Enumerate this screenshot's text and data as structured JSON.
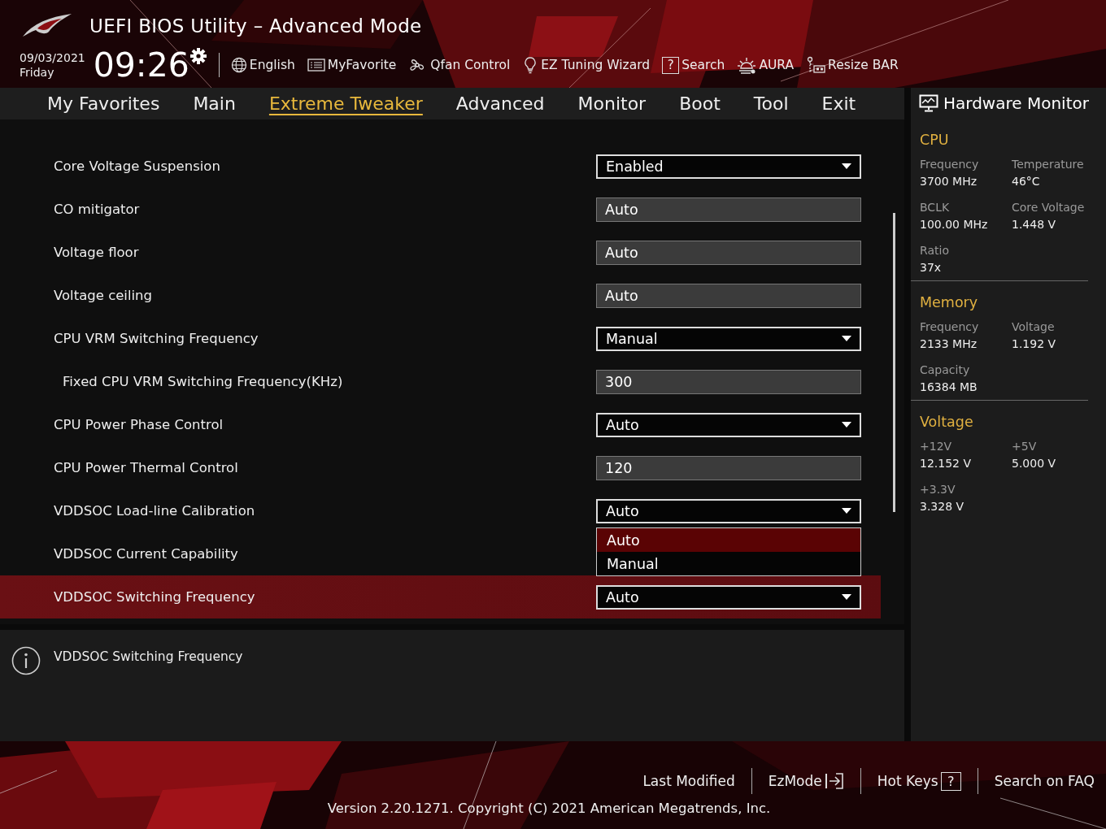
{
  "header": {
    "title": "UEFI BIOS Utility – Advanced Mode",
    "date": "09/03/2021",
    "day": "Friday",
    "time": "09:26",
    "toolbar": [
      {
        "kind": "globe",
        "label": "English"
      },
      {
        "kind": "list",
        "label": "MyFavorite"
      },
      {
        "kind": "fan",
        "label": "Qfan Control"
      },
      {
        "kind": "bulb",
        "label": "EZ Tuning Wizard"
      },
      {
        "kind": "glyph",
        "glyph": "?",
        "label": "Search"
      },
      {
        "kind": "sun",
        "label": "AURA"
      },
      {
        "kind": "card",
        "label": "Resize BAR"
      }
    ]
  },
  "tabs": [
    {
      "label": "My Favorites",
      "selected": false
    },
    {
      "label": "Main",
      "selected": false
    },
    {
      "label": "Extreme Tweaker",
      "selected": true
    },
    {
      "label": "Advanced",
      "selected": false
    },
    {
      "label": "Monitor",
      "selected": false
    },
    {
      "label": "Boot",
      "selected": false
    },
    {
      "label": "Tool",
      "selected": false
    },
    {
      "label": "Exit",
      "selected": false
    }
  ],
  "settings": [
    {
      "label": "Core Voltage Suspension",
      "kind": "dropdown",
      "value": "Enabled",
      "selected": false
    },
    {
      "label": "CO mitigator",
      "kind": "field",
      "value": "Auto",
      "selected": false
    },
    {
      "label": "Voltage floor",
      "kind": "field",
      "value": "Auto",
      "selected": false
    },
    {
      "label": "Voltage ceiling",
      "kind": "field",
      "value": "Auto",
      "selected": false
    },
    {
      "label": "CPU VRM Switching Frequency",
      "kind": "dropdown",
      "value": "Manual",
      "selected": false,
      "children": [
        {
          "label": "Fixed CPU VRM Switching Frequency(KHz)",
          "kind": "field",
          "value": "300",
          "selected": false
        }
      ]
    },
    {
      "label": "CPU Power Phase Control",
      "kind": "dropdown",
      "value": "Auto",
      "selected": false
    },
    {
      "label": "CPU Power Thermal Control",
      "kind": "field",
      "value": "120",
      "selected": false
    },
    {
      "label": "VDDSOC Load-line Calibration",
      "kind": "dropdown",
      "value": "Auto",
      "selected": false,
      "expanded": true,
      "options": [
        {
          "label": "Auto",
          "selected": true
        },
        {
          "label": "Manual",
          "selected": false
        }
      ]
    },
    {
      "label": "VDDSOC Current Capability",
      "selected": false
    },
    {
      "label": "VDDSOC Switching Frequency",
      "kind": "dropdown",
      "value": "Auto",
      "selected": true
    }
  ],
  "help": {
    "text": "VDDSOC Switching Frequency"
  },
  "hardware_monitor": {
    "title": "Hardware Monitor",
    "sections": [
      {
        "title": "CPU",
        "items": [
          {
            "label": "Frequency",
            "value": "3700 MHz"
          },
          {
            "label": "Temperature",
            "value": "46°C"
          },
          {
            "label": "BCLK",
            "value": "100.00 MHz"
          },
          {
            "label": "Core Voltage",
            "value": "1.448 V"
          },
          {
            "label": "Ratio",
            "value": "37x"
          }
        ]
      },
      {
        "title": "Memory",
        "items": [
          {
            "label": "Frequency",
            "value": "2133 MHz"
          },
          {
            "label": "Voltage",
            "value": "1.192 V"
          },
          {
            "label": "Capacity",
            "value": "16384 MB"
          }
        ]
      },
      {
        "title": "Voltage",
        "items": [
          {
            "label": "+12V",
            "value": "12.152 V"
          },
          {
            "label": "+5V",
            "value": "5.000 V"
          },
          {
            "label": "+3.3V",
            "value": "3.328 V"
          }
        ]
      }
    ]
  },
  "footer": {
    "links": [
      {
        "kind": "text",
        "label": "Last Modified"
      },
      {
        "kind": "exit",
        "label": "EzMode"
      },
      {
        "kind": "glyph",
        "glyph": "?",
        "label": "Hot Keys"
      },
      {
        "kind": "text",
        "label": "Search on FAQ"
      }
    ],
    "version": "Version 2.20.1271. Copyright (C) 2021 American Megatrends, Inc."
  }
}
